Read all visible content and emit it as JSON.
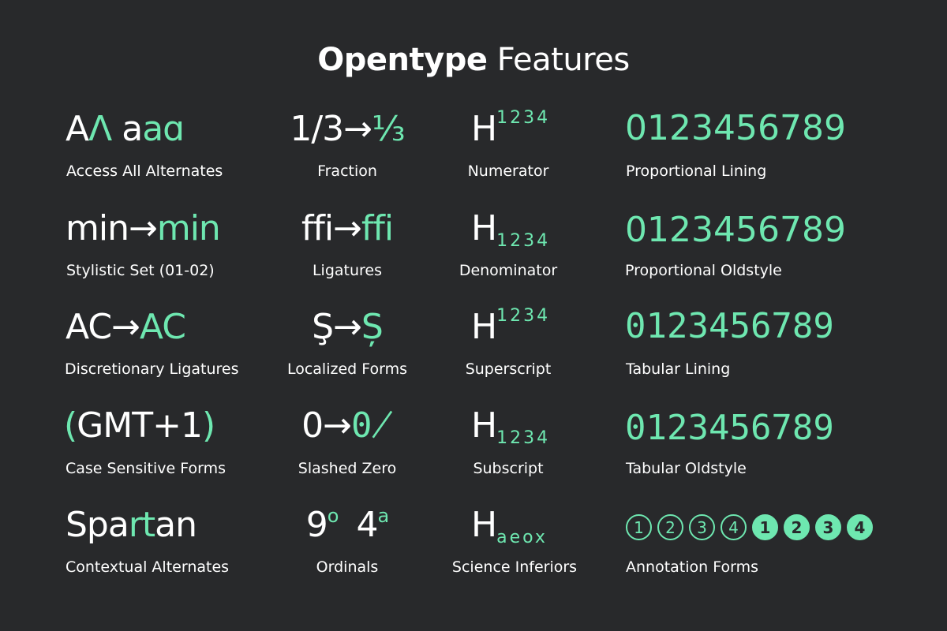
{
  "title": {
    "bold": "Opentype",
    "light": "Features"
  },
  "features": {
    "aalt": {
      "w1": "A",
      "g1": "Λ",
      "w2": "a",
      "g2": "aɑ",
      "label": "Access All Alternates"
    },
    "frac": {
      "w": "1/3→",
      "g": "⅓",
      "label": "Fraction"
    },
    "numr": {
      "w": "H",
      "g": "1234",
      "label": "Numerator"
    },
    "pnum": {
      "g": "0123456789",
      "label": "Proportional Lining"
    },
    "ss": {
      "w": "min→",
      "g": "min",
      "label": "Stylistic Set (01-02)"
    },
    "liga": {
      "w": "ffi→",
      "g": "ffi",
      "label": "Ligatures"
    },
    "dnom": {
      "w": "H",
      "g": "1234",
      "label": "Denominator"
    },
    "onum": {
      "g": "0123456789",
      "label": "Proportional Oldstyle"
    },
    "dlig": {
      "w": "AC→",
      "g": "AC",
      "label": "Discretionary Ligatures"
    },
    "locl": {
      "w": "Ş→",
      "g": "Ș",
      "label": "Localized Forms"
    },
    "sups": {
      "w": "H",
      "g": "1234",
      "label": "Superscript"
    },
    "tnum": {
      "g": "0123456789",
      "label": "Tabular Lining"
    },
    "case": {
      "g1": "(",
      "w": "GMT+1",
      "g2": ")",
      "label": "Case Sensitive Forms"
    },
    "zero": {
      "w": "0→",
      "g": "0̸",
      "label": "Slashed Zero"
    },
    "subs": {
      "w": "H",
      "g": "1234",
      "label": "Subscript"
    },
    "tosf": {
      "g": "0123456789",
      "label": "Tabular Oldstyle"
    },
    "calt": {
      "w1": "Spa",
      "g": "rt",
      "w2": "an",
      "label": "Contextual Alternates"
    },
    "ordn": {
      "w1": "9",
      "g1": "o",
      "w2": "4",
      "g2": "a",
      "label": "Ordinals"
    },
    "sinf": {
      "w": "H",
      "g": "aeox",
      "label": "Science Inferiors"
    },
    "nalt": {
      "outline": [
        "1",
        "2",
        "3",
        "4"
      ],
      "filled": [
        "1",
        "2",
        "3",
        "4"
      ],
      "label": "Annotation Forms"
    }
  },
  "colors": {
    "background": "#28292b",
    "accent": "#6ee7b0",
    "text": "#ffffff"
  }
}
